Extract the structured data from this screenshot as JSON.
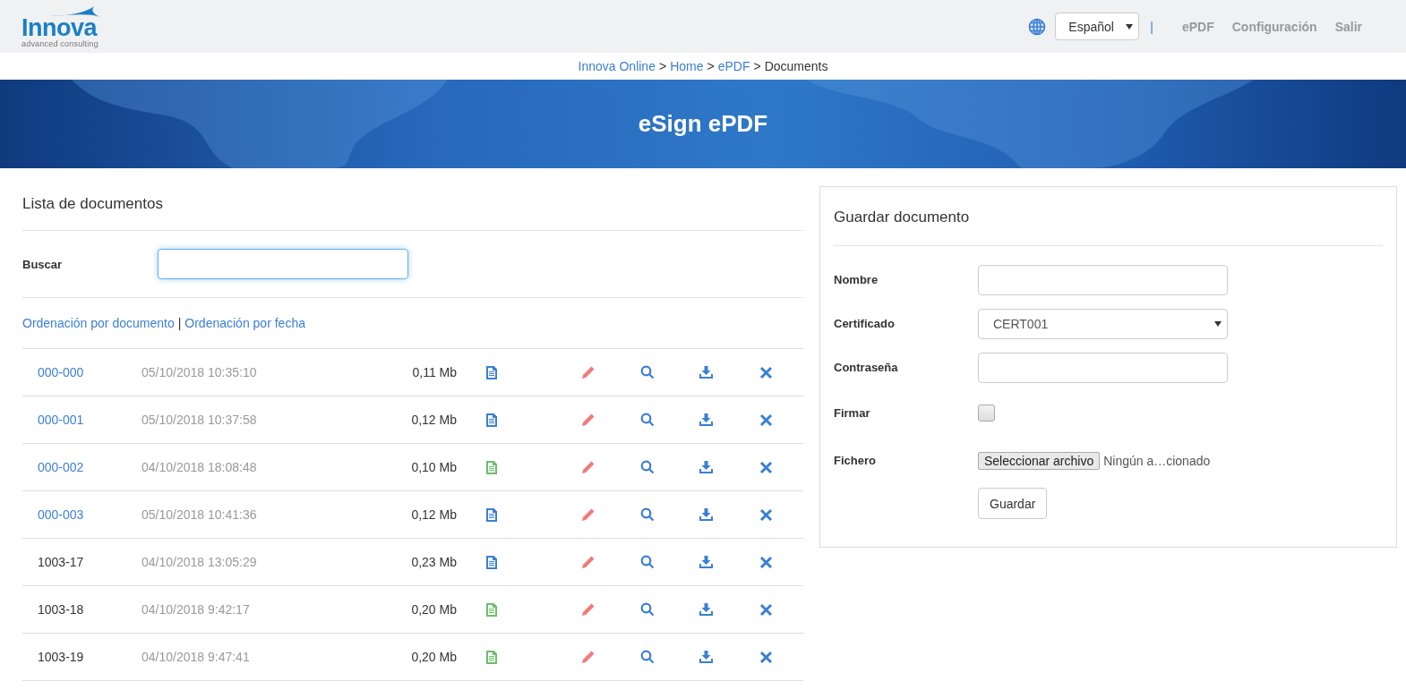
{
  "header": {
    "logo": {
      "name": "Innova",
      "tagline": "advanced consulting"
    },
    "language": "Español",
    "separator": "|",
    "nav": [
      "ePDF",
      "Configuración",
      "Salir"
    ]
  },
  "breadcrumb": [
    {
      "label": "Innova Online",
      "link": true
    },
    {
      "label": ">",
      "link": false
    },
    {
      "label": "Home",
      "link": true
    },
    {
      "label": ">",
      "link": false
    },
    {
      "label": "ePDF",
      "link": true
    },
    {
      "label": ">",
      "link": false
    },
    {
      "label": "Documents",
      "link": false
    }
  ],
  "banner": {
    "title": "eSign ePDF"
  },
  "document_list": {
    "title": "Lista de documentos",
    "search": {
      "label": "Buscar",
      "focused": true
    },
    "sort_links": [
      {
        "label": "Ordenación por documento",
        "kind": "link"
      },
      {
        "label": "|",
        "kind": "separator"
      },
      {
        "label": "Ordenación por fecha",
        "kind": "link"
      }
    ],
    "rows": [
      {
        "id": "000-000",
        "link": true,
        "date": "05/10/2018 10:35:10",
        "size": "0,11 Mb",
        "color": "#3a7fd5"
      },
      {
        "id": "000-001",
        "link": true,
        "date": "05/10/2018 10:37:58",
        "size": "0,12 Mb",
        "color": "#3a7fd5"
      },
      {
        "id": "000-002",
        "link": true,
        "date": "04/10/2018 18:08:48",
        "size": "0,10 Mb",
        "color": "#6cbf6c"
      },
      {
        "id": "000-003",
        "link": true,
        "date": "05/10/2018 10:41:36",
        "size": "0,12 Mb",
        "color": "#3a7fd5"
      },
      {
        "id": "1003-17",
        "link": false,
        "date": "04/10/2018 13:05:29",
        "size": "0,23 Mb",
        "color": "#3a7fd5"
      },
      {
        "id": "1003-18",
        "link": false,
        "date": "04/10/2018 9:42:17",
        "size": "0,20 Mb",
        "color": "#6cbf6c"
      },
      {
        "id": "1003-19",
        "link": false,
        "date": "04/10/2018 9:47:41",
        "size": "0,20 Mb",
        "color": "#6cbf6c"
      }
    ]
  },
  "save_form": {
    "title": "Guardar documento",
    "fields": [
      {
        "label": "Nombre",
        "kind": "text"
      },
      {
        "label": "Certificado",
        "kind": "select",
        "value": "CERT001"
      },
      {
        "label": "Contraseña",
        "kind": "password"
      },
      {
        "label": "Firmar",
        "kind": "checkbox",
        "checked": false
      },
      {
        "label": "Fichero",
        "kind": "file",
        "button": "Seleccionar archivo",
        "value": "Ningún a…cionado"
      }
    ],
    "submit": "Guardar"
  }
}
